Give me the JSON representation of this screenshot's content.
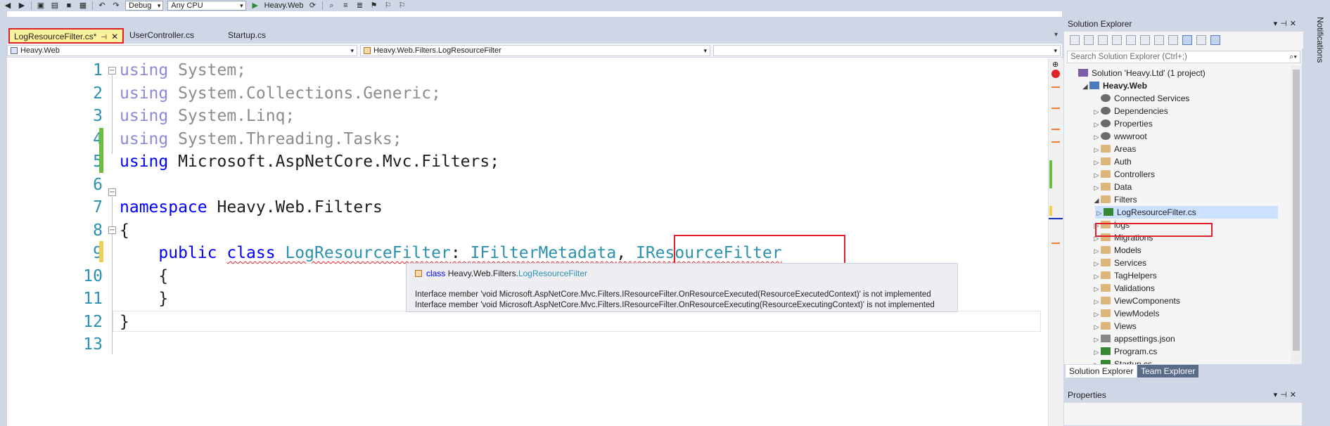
{
  "toolbar": {
    "config": "Debug",
    "platform": "Any CPU",
    "run_label": "Heavy.Web"
  },
  "tabs": [
    {
      "label": "LogResourceFilter.cs*",
      "active": true
    },
    {
      "label": "UserController.cs",
      "active": false
    },
    {
      "label": "Startup.cs",
      "active": false
    }
  ],
  "nav": {
    "project": "Heavy.Web",
    "type": "Heavy.Web.Filters.LogResourceFilter",
    "member": ""
  },
  "code": {
    "lines": [
      {
        "n": "1",
        "parts": [
          [
            "kw-dim",
            "using"
          ],
          [
            "dim",
            " System;"
          ]
        ]
      },
      {
        "n": "2",
        "parts": [
          [
            "kw-dim",
            "using"
          ],
          [
            "dim",
            " System.Collections.Generic;"
          ]
        ]
      },
      {
        "n": "3",
        "parts": [
          [
            "kw-dim",
            "using"
          ],
          [
            "dim",
            " System.Linq;"
          ]
        ]
      },
      {
        "n": "4",
        "parts": [
          [
            "kw-dim",
            "using"
          ],
          [
            "dim",
            " System.Threading.Tasks;"
          ]
        ]
      },
      {
        "n": "5",
        "parts": [
          [
            "kw",
            "using"
          ],
          [
            "plain",
            " Microsoft.AspNetCore.Mvc.Filters;"
          ]
        ]
      },
      {
        "n": "6",
        "parts": []
      },
      {
        "n": "7",
        "parts": [
          [
            "kw",
            "namespace"
          ],
          [
            "plain",
            " Heavy.Web.Filters"
          ]
        ]
      },
      {
        "n": "8",
        "parts": [
          [
            "plain",
            "{"
          ]
        ]
      },
      {
        "n": "9",
        "parts": [
          [
            "plain",
            "    "
          ],
          [
            "kw",
            "public"
          ],
          [
            "plain",
            " "
          ],
          [
            "kw squig",
            "class"
          ],
          [
            "plain squig",
            " "
          ],
          [
            "ty squig",
            "LogResourceFilter"
          ],
          [
            "plain squig",
            ": "
          ],
          [
            "ty squig",
            "IFilterMetadata"
          ],
          [
            "plain squig",
            ", "
          ],
          [
            "ty squig",
            "IResourceFilter"
          ]
        ]
      },
      {
        "n": "10",
        "parts": [
          [
            "plain",
            "    {"
          ]
        ]
      },
      {
        "n": "11",
        "parts": [
          [
            "plain",
            "    }"
          ]
        ]
      },
      {
        "n": "12",
        "parts": [
          [
            "plain",
            "}"
          ]
        ]
      },
      {
        "n": "13",
        "parts": []
      }
    ]
  },
  "tooltip": {
    "keyword": "class",
    "namespace": "Heavy.Web.Filters.",
    "type": "LogResourceFilter",
    "message1": "Interface member 'void Microsoft.AspNetCore.Mvc.Filters.IResourceFilter.OnResourceExecuted(ResourceExecutedContext)' is not implemented",
    "message2": "Interface member 'void Microsoft.AspNetCore.Mvc.Filters.IResourceFilter.OnResourceExecuting(ResourceExecutingContext)' is not implemented"
  },
  "solution_explorer": {
    "title": "Solution Explorer",
    "search_placeholder": "Search Solution Explorer (Ctrl+;)",
    "nodes": [
      {
        "label": "Solution 'Heavy.Ltd' (1 project)",
        "depth": 0,
        "icon": "sln",
        "twisty": "",
        "bold": false
      },
      {
        "label": "Heavy.Web",
        "depth": 1,
        "icon": "proj",
        "twisty": "◢",
        "bold": true
      },
      {
        "label": "Connected Services",
        "depth": 2,
        "icon": "gear",
        "twisty": "",
        "bold": false
      },
      {
        "label": "Dependencies",
        "depth": 2,
        "icon": "gear",
        "twisty": "▷",
        "bold": false
      },
      {
        "label": "Properties",
        "depth": 2,
        "icon": "gear",
        "twisty": "▷",
        "bold": false
      },
      {
        "label": "wwwroot",
        "depth": 2,
        "icon": "gear",
        "twisty": "▷",
        "bold": false
      },
      {
        "label": "Areas",
        "depth": 2,
        "icon": "folder",
        "twisty": "▷",
        "bold": false
      },
      {
        "label": "Auth",
        "depth": 2,
        "icon": "folder",
        "twisty": "▷",
        "bold": false
      },
      {
        "label": "Controllers",
        "depth": 2,
        "icon": "folder",
        "twisty": "▷",
        "bold": false
      },
      {
        "label": "Data",
        "depth": 2,
        "icon": "folder",
        "twisty": "▷",
        "bold": false
      },
      {
        "label": "Filters",
        "depth": 2,
        "icon": "folder",
        "twisty": "◢",
        "bold": false
      },
      {
        "label": "LogResourceFilter.cs",
        "depth": 3,
        "icon": "cs",
        "twisty": "▷",
        "bold": false,
        "selected": true
      },
      {
        "label": "logs",
        "depth": 2,
        "icon": "folder",
        "twisty": "▷",
        "bold": false
      },
      {
        "label": "Migrations",
        "depth": 2,
        "icon": "folder",
        "twisty": "▷",
        "bold": false
      },
      {
        "label": "Models",
        "depth": 2,
        "icon": "folder",
        "twisty": "▷",
        "bold": false
      },
      {
        "label": "Services",
        "depth": 2,
        "icon": "folder",
        "twisty": "▷",
        "bold": false
      },
      {
        "label": "TagHelpers",
        "depth": 2,
        "icon": "folder",
        "twisty": "▷",
        "bold": false
      },
      {
        "label": "Validations",
        "depth": 2,
        "icon": "folder",
        "twisty": "▷",
        "bold": false
      },
      {
        "label": "ViewComponents",
        "depth": 2,
        "icon": "folder",
        "twisty": "▷",
        "bold": false
      },
      {
        "label": "ViewModels",
        "depth": 2,
        "icon": "folder",
        "twisty": "▷",
        "bold": false
      },
      {
        "label": "Views",
        "depth": 2,
        "icon": "folder",
        "twisty": "▷",
        "bold": false
      },
      {
        "label": "appsettings.json",
        "depth": 2,
        "icon": "json",
        "twisty": "▷",
        "bold": false
      },
      {
        "label": "Program.cs",
        "depth": 2,
        "icon": "cs",
        "twisty": "▷",
        "bold": false
      },
      {
        "label": "Startup.cs",
        "depth": 2,
        "icon": "cs",
        "twisty": "▷",
        "bold": false
      }
    ],
    "tabs": [
      {
        "label": "Solution Explorer",
        "active": true
      },
      {
        "label": "Team Explorer",
        "active": false
      }
    ]
  },
  "properties": {
    "title": "Properties"
  },
  "notifications": {
    "label": "Notifications"
  },
  "colors": {
    "accent_red": "#e0202a",
    "keyword": "#0000ff",
    "type": "#2b91af"
  }
}
